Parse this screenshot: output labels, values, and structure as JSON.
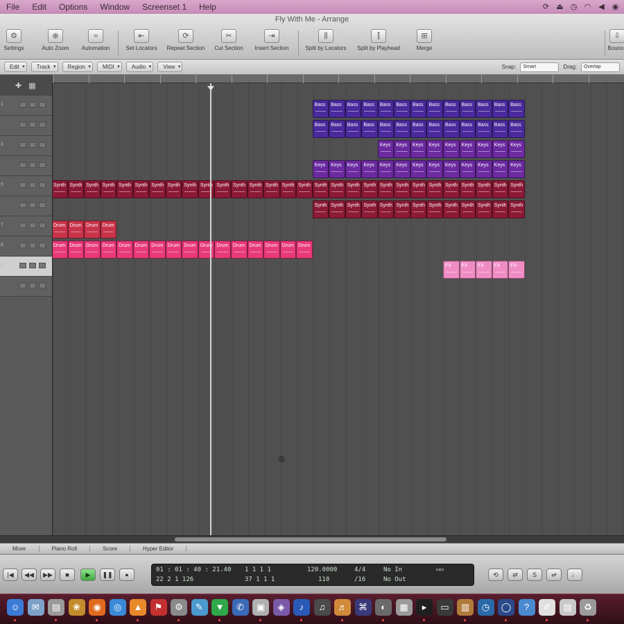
{
  "menubar": {
    "items": [
      "File",
      "Edit",
      "Options",
      "Window",
      "Screenset 1",
      "Help"
    ],
    "status_icons": [
      "time-machine-icon",
      "eject-icon",
      "sync-icon",
      "wifi-icon",
      "volume-icon",
      "user-icon"
    ]
  },
  "window": {
    "title": "Fly With Me - Arrange"
  },
  "toolbar": {
    "items": [
      {
        "label": "Settings",
        "icon": "settings-icon"
      },
      {
        "label": "Auto Zoom",
        "icon": "zoom-icon"
      },
      {
        "label": "Automation",
        "icon": "automation-icon"
      },
      {
        "label": "Set Locators",
        "icon": "locators-icon"
      },
      {
        "label": "Repeat Section",
        "icon": "repeat-icon"
      },
      {
        "label": "Cut Section",
        "icon": "cut-icon"
      },
      {
        "label": "Insert Section",
        "icon": "insert-icon"
      },
      {
        "label": "Split by Locators",
        "icon": "split-locators-icon"
      },
      {
        "label": "Split by Playhead",
        "icon": "split-playhead-icon"
      },
      {
        "label": "Merge",
        "icon": "merge-icon"
      },
      {
        "label": "Bounce",
        "icon": "bounce-icon"
      }
    ]
  },
  "localbar": {
    "menus": [
      "Edit",
      "Track",
      "Region",
      "MIDI",
      "Audio",
      "View"
    ],
    "snap_label": "Snap:",
    "snap_value": "Smart",
    "drag_label": "Drag:",
    "drag_value": "Overlap"
  },
  "tracklist": {
    "rows": [
      {
        "num": "1",
        "selected": false
      },
      {
        "num": "",
        "selected": false
      },
      {
        "num": "3",
        "selected": false
      },
      {
        "num": "",
        "selected": false
      },
      {
        "num": "5",
        "selected": false
      },
      {
        "num": "",
        "selected": false
      },
      {
        "num": "7",
        "selected": false
      },
      {
        "num": "8",
        "selected": false
      },
      {
        "num": "9",
        "selected": true
      },
      {
        "num": "",
        "selected": false
      }
    ]
  },
  "ruler": {
    "bar_count": 17
  },
  "arrange": {
    "grid_bars": 35,
    "colors": {
      "indigo": "#4a2a9c",
      "purple": "#6b2aa0",
      "crimson": "#8c1a36",
      "red": "#c8334a",
      "pink": "#e83a78",
      "light_pink": "#f08cc4"
    },
    "playhead_bar": 10,
    "regions": [
      {
        "track": 0,
        "start": 16,
        "count": 13,
        "color": "indigo",
        "label": "Bass"
      },
      {
        "track": 1,
        "start": 16,
        "count": 13,
        "color": "indigo",
        "label": "Bass"
      },
      {
        "track": 2,
        "start": 20,
        "count": 9,
        "color": "purple",
        "label": "Keys"
      },
      {
        "track": 3,
        "start": 16,
        "count": 13,
        "color": "purple",
        "label": "Keys"
      },
      {
        "track": 4,
        "start": 0,
        "count": 29,
        "color": "crimson",
        "label": "Synth"
      },
      {
        "track": 5,
        "start": 16,
        "count": 13,
        "color": "crimson",
        "label": "Synth"
      },
      {
        "track": 6,
        "start": 0,
        "count": 4,
        "color": "red",
        "label": "Drum"
      },
      {
        "track": 7,
        "start": 0,
        "count": 16,
        "color": "pink",
        "label": "Drum"
      },
      {
        "track": 8,
        "start": 24,
        "count": 5,
        "color": "light_pink",
        "label": "FX"
      }
    ]
  },
  "bottomtabs": [
    "Mixer",
    "Piano Roll",
    "Score",
    "Hyper Editor"
  ],
  "transport": {
    "buttons": [
      {
        "icon": "rewind-start-icon",
        "glyph": "|◀"
      },
      {
        "icon": "rewind-icon",
        "glyph": "◀◀"
      },
      {
        "icon": "forward-icon",
        "glyph": "▶▶"
      },
      {
        "icon": "stop-icon",
        "glyph": "■"
      },
      {
        "icon": "play-icon",
        "glyph": "▶"
      },
      {
        "icon": "pause-icon",
        "glyph": "❚❚"
      },
      {
        "icon": "record-icon",
        "glyph": "●"
      }
    ],
    "right_buttons": [
      {
        "icon": "cycle-icon",
        "glyph": "⟲"
      },
      {
        "icon": "replace-icon",
        "glyph": "⇄"
      },
      {
        "icon": "solo-icon",
        "glyph": "S"
      },
      {
        "icon": "sync-icon",
        "glyph": "⇌"
      },
      {
        "icon": "metronome-icon",
        "glyph": "♩"
      }
    ],
    "lcd": {
      "smpte": "01 : 01 : 40 : 21.40",
      "bars": "22  2  1 126",
      "left_locator": "1  1  1  1",
      "right_locator": "37  1  1  1",
      "tempo": "120.0000",
      "tempo_sub": "110",
      "signature": "4/4",
      "division": "/16",
      "midi_in": "No In",
      "midi_out": "No Out"
    }
  },
  "dock": {
    "icons": [
      "finder-icon",
      "mail-icon",
      "disk-icon",
      "photo-icon",
      "firefox-icon",
      "browser-icon",
      "vlc-icon",
      "reader-icon",
      "utility-icon",
      "pages-icon",
      "bittorrent-icon",
      "chat-icon",
      "photo-browser-icon",
      "preview-icon",
      "audio-icon",
      "logic-icon",
      "garageband-icon",
      "network-icon",
      "camera-icon",
      "calculator-icon",
      "terminal-icon",
      "monitor-icon",
      "archive-icon",
      "clock-icon",
      "globe-icon",
      "help-icon",
      "notes-icon",
      "stack-icon",
      "trash-icon"
    ]
  }
}
